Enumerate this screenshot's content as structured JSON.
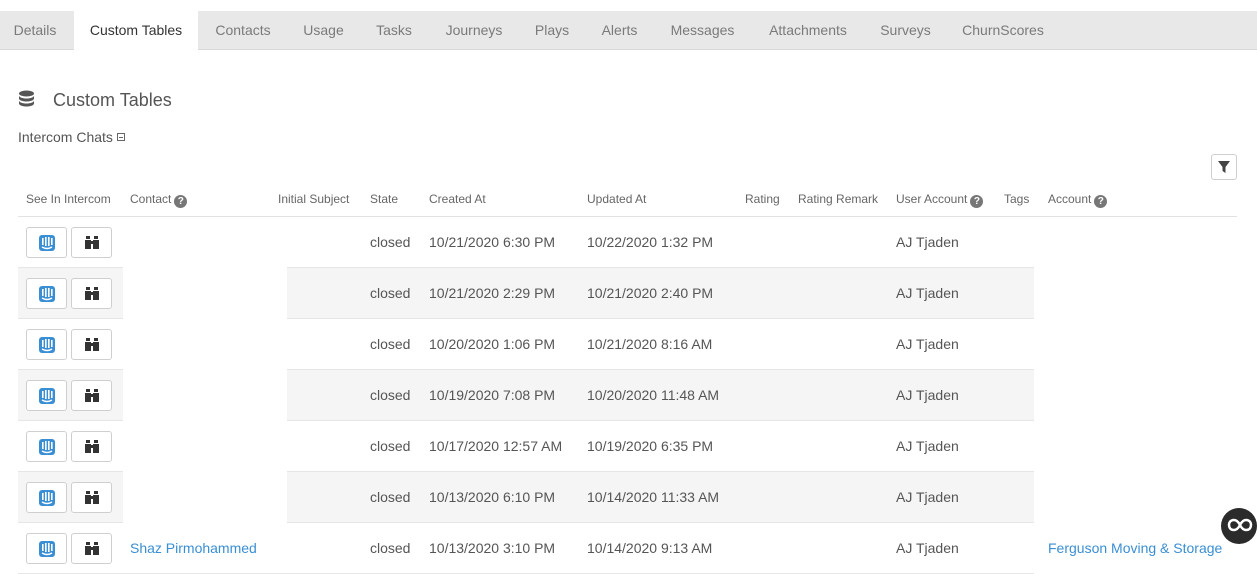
{
  "tabs": [
    {
      "label": "Details",
      "active": false
    },
    {
      "label": "Custom Tables",
      "active": true
    },
    {
      "label": "Contacts",
      "active": false
    },
    {
      "label": "Usage",
      "active": false
    },
    {
      "label": "Tasks",
      "active": false
    },
    {
      "label": "Journeys",
      "active": false
    },
    {
      "label": "Plays",
      "active": false
    },
    {
      "label": "Alerts",
      "active": false
    },
    {
      "label": "Messages",
      "active": false
    },
    {
      "label": "Attachments",
      "active": false
    },
    {
      "label": "Surveys",
      "active": false
    },
    {
      "label": "ChurnScores",
      "active": false
    }
  ],
  "section": {
    "title": "Custom Tables",
    "icon": "database-icon"
  },
  "subtable": {
    "label": "Intercom Chats",
    "toggle_icon": "collapse-icon"
  },
  "table": {
    "columns": [
      "See In Intercom",
      "Contact",
      "Initial Subject",
      "State",
      "Created At",
      "Updated At",
      "Rating",
      "Rating Remark",
      "User Account",
      "Tags",
      "Account"
    ],
    "rows": [
      {
        "contact": "",
        "state": "closed",
        "created": "10/21/2020 6:30 PM",
        "updated": "10/22/2020 1:32 PM",
        "user": "AJ Tjaden",
        "account": ""
      },
      {
        "contact": "",
        "state": "closed",
        "created": "10/21/2020 2:29 PM",
        "updated": "10/21/2020 2:40 PM",
        "user": "AJ Tjaden",
        "account": ""
      },
      {
        "contact": "",
        "state": "closed",
        "created": "10/20/2020 1:06 PM",
        "updated": "10/21/2020 8:16 AM",
        "user": "AJ Tjaden",
        "account": ""
      },
      {
        "contact": "",
        "state": "closed",
        "created": "10/19/2020 7:08 PM",
        "updated": "10/20/2020 11:48 AM",
        "user": "AJ Tjaden",
        "account": ""
      },
      {
        "contact": "",
        "state": "closed",
        "created": "10/17/2020 12:57 AM",
        "updated": "10/19/2020 6:35 PM",
        "user": "AJ Tjaden",
        "account": ""
      },
      {
        "contact": "",
        "state": "closed",
        "created": "10/13/2020 6:10 PM",
        "updated": "10/14/2020 11:33 AM",
        "user": "AJ Tjaden",
        "account": ""
      },
      {
        "contact": "Shaz Pirmohammed",
        "state": "closed",
        "created": "10/13/2020 3:10 PM",
        "updated": "10/14/2020 9:13 AM",
        "user": "AJ Tjaden",
        "account": "Ferguson Moving & Storage"
      }
    ]
  },
  "colors": {
    "accent": "#3a8fd4",
    "intercom_icon": "#3a8fd4"
  }
}
